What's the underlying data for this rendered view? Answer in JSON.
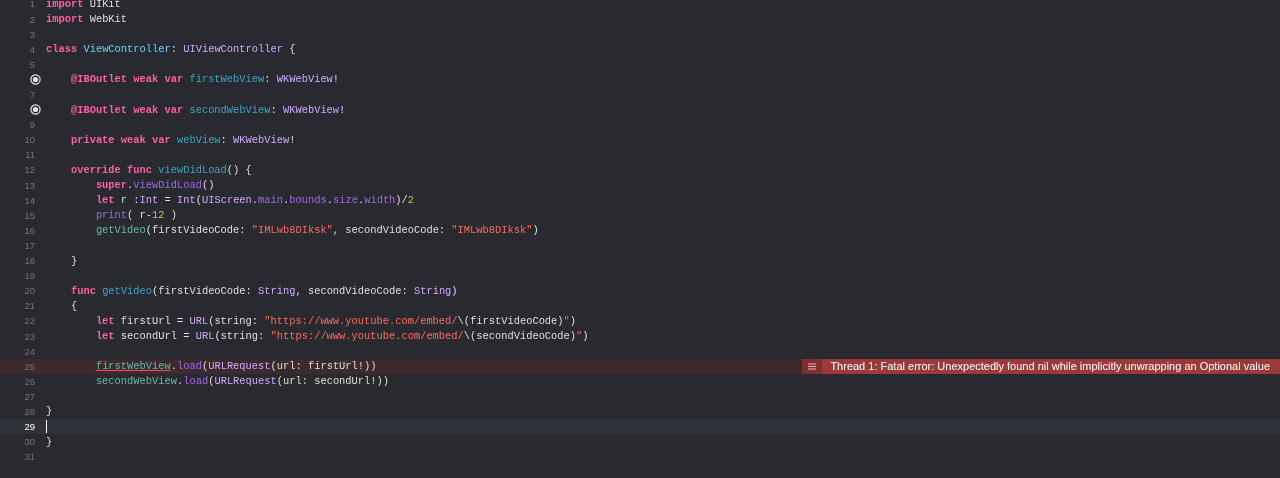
{
  "editor": {
    "lines": [
      {
        "number": "1",
        "current": false,
        "tokens": [
          {
            "text": "import",
            "kind": "keyword"
          },
          {
            "text": " UIKit",
            "kind": "plain"
          }
        ]
      },
      {
        "number": "2",
        "current": false,
        "tokens": [
          {
            "text": "import",
            "kind": "keyword"
          },
          {
            "text": " WebKit",
            "kind": "plain"
          }
        ]
      },
      {
        "number": "3",
        "current": false
      },
      {
        "number": "4",
        "current": false,
        "tokens": [
          {
            "text": "class ",
            "kind": "keyword"
          },
          {
            "text": "ViewController",
            "kind": "type-declaration"
          },
          {
            "text": ": ",
            "kind": "plain"
          },
          {
            "text": "UIViewController",
            "kind": "type"
          },
          {
            "text": " {",
            "kind": "plain"
          }
        ]
      },
      {
        "number": "5",
        "current": false
      },
      {
        "outlet": true,
        "current": false,
        "tokens": [
          {
            "text": "    @IBOutlet weak var ",
            "kind": "keyword"
          },
          {
            "text": "firstWebView",
            "kind": "declaration"
          },
          {
            "text": ": ",
            "kind": "plain"
          },
          {
            "text": "WKWebView",
            "kind": "type"
          },
          {
            "text": "!",
            "kind": "plain"
          }
        ]
      },
      {
        "number": "7",
        "current": false
      },
      {
        "outlet": true,
        "current": false,
        "tokens": [
          {
            "text": "    @IBOutlet weak var ",
            "kind": "keyword"
          },
          {
            "text": "secondWebView",
            "kind": "declaration"
          },
          {
            "text": ": ",
            "kind": "plain"
          },
          {
            "text": "WKWebView",
            "kind": "type"
          },
          {
            "text": "!",
            "kind": "plain"
          }
        ]
      },
      {
        "number": "9",
        "current": false
      },
      {
        "number": "10",
        "current": false,
        "tokens": [
          {
            "text": "    private weak var ",
            "kind": "keyword"
          },
          {
            "text": "webView",
            "kind": "declaration"
          },
          {
            "text": ": ",
            "kind": "plain"
          },
          {
            "text": "WKWebView",
            "kind": "type"
          },
          {
            "text": "!",
            "kind": "plain"
          }
        ]
      },
      {
        "number": "11",
        "current": false
      },
      {
        "number": "12",
        "current": false,
        "tokens": [
          {
            "text": "    override func ",
            "kind": "keyword"
          },
          {
            "text": "viewDidLoad",
            "kind": "declaration"
          },
          {
            "text": "() {",
            "kind": "plain"
          }
        ]
      },
      {
        "number": "13",
        "current": false,
        "tokens": [
          {
            "text": "        super",
            "kind": "keyword"
          },
          {
            "text": ".",
            "kind": "plain"
          },
          {
            "text": "viewDidLoad",
            "kind": "method"
          },
          {
            "text": "()",
            "kind": "plain"
          }
        ]
      },
      {
        "number": "14",
        "current": false,
        "tokens": [
          {
            "text": "        let",
            "kind": "keyword"
          },
          {
            "text": " r :",
            "kind": "plain"
          },
          {
            "text": "Int",
            "kind": "type"
          },
          {
            "text": " = ",
            "kind": "plain"
          },
          {
            "text": "Int",
            "kind": "type"
          },
          {
            "text": "(",
            "kind": "plain"
          },
          {
            "text": "UIScreen",
            "kind": "type"
          },
          {
            "text": ".",
            "kind": "plain"
          },
          {
            "text": "main",
            "kind": "method"
          },
          {
            "text": ".",
            "kind": "plain"
          },
          {
            "text": "bounds",
            "kind": "method"
          },
          {
            "text": ".",
            "kind": "plain"
          },
          {
            "text": "size",
            "kind": "method"
          },
          {
            "text": ".",
            "kind": "plain"
          },
          {
            "text": "width",
            "kind": "method"
          },
          {
            "text": ")/",
            "kind": "plain"
          },
          {
            "text": "2",
            "kind": "number"
          }
        ]
      },
      {
        "number": "15",
        "current": false,
        "tokens": [
          {
            "text": "        print",
            "kind": "method"
          },
          {
            "text": "( r-",
            "kind": "plain"
          },
          {
            "text": "12",
            "kind": "number"
          },
          {
            "text": " )",
            "kind": "plain"
          }
        ]
      },
      {
        "number": "16",
        "current": false,
        "tokens": [
          {
            "text": "        getVideo",
            "kind": "project"
          },
          {
            "text": "(firstVideoCode: ",
            "kind": "plain"
          },
          {
            "text": "\"IMLwb8DIksk\"",
            "kind": "string"
          },
          {
            "text": ", secondVideoCode: ",
            "kind": "plain"
          },
          {
            "text": "\"IMLwb8DIksk\"",
            "kind": "string"
          },
          {
            "text": ")",
            "kind": "plain"
          }
        ]
      },
      {
        "number": "17",
        "current": false
      },
      {
        "number": "18",
        "current": false,
        "tokens": [
          {
            "text": "    }",
            "kind": "plain"
          }
        ]
      },
      {
        "number": "19",
        "current": false
      },
      {
        "number": "20",
        "current": false,
        "tokens": [
          {
            "text": "    func ",
            "kind": "keyword"
          },
          {
            "text": "getVideo",
            "kind": "declaration"
          },
          {
            "text": "(firstVideoCode: ",
            "kind": "plain"
          },
          {
            "text": "String",
            "kind": "type"
          },
          {
            "text": ", secondVideoCode: ",
            "kind": "plain"
          },
          {
            "text": "String",
            "kind": "type"
          },
          {
            "text": ")",
            "kind": "plain"
          }
        ]
      },
      {
        "number": "21",
        "current": false,
        "tokens": [
          {
            "text": "    {",
            "kind": "plain"
          }
        ]
      },
      {
        "number": "22",
        "current": false,
        "tokens": [
          {
            "text": "        let",
            "kind": "keyword"
          },
          {
            "text": " firstUrl = ",
            "kind": "plain"
          },
          {
            "text": "URL",
            "kind": "type"
          },
          {
            "text": "(string: ",
            "kind": "plain"
          },
          {
            "text": "\"https://www.youtube.com/embed/",
            "kind": "string"
          },
          {
            "text": "\\(firstVideoCode)",
            "kind": "plain"
          },
          {
            "text": "\"",
            "kind": "string"
          },
          {
            "text": ")",
            "kind": "plain"
          }
        ]
      },
      {
        "number": "23",
        "current": false,
        "tokens": [
          {
            "text": "        let",
            "kind": "keyword"
          },
          {
            "text": " secondUrl = ",
            "kind": "plain"
          },
          {
            "text": "URL",
            "kind": "type"
          },
          {
            "text": "(string: ",
            "kind": "plain"
          },
          {
            "text": "\"https://www.youtube.com/embed/",
            "kind": "string"
          },
          {
            "text": "\\(secondVideoCode)",
            "kind": "plain"
          },
          {
            "text": "\"",
            "kind": "string"
          },
          {
            "text": ")",
            "kind": "plain"
          }
        ]
      },
      {
        "number": "24",
        "current": false
      },
      {
        "number": "25",
        "current": false,
        "error_message": "Thread 1: Fatal error: Unexpectedly found nil while implicitly unwrapping an Optional value",
        "tokens": [
          {
            "text": "        firstWebView",
            "kind": "error-symbol"
          },
          {
            "text": ".",
            "kind": "plain"
          },
          {
            "text": "load",
            "kind": "method"
          },
          {
            "text": "(",
            "kind": "plain"
          },
          {
            "text": "URLRequest",
            "kind": "type"
          },
          {
            "text": "(url: firstUrl!))",
            "kind": "plain"
          }
        ]
      },
      {
        "number": "26",
        "current": false,
        "tokens": [
          {
            "text": "        secondWebView",
            "kind": "project"
          },
          {
            "text": ".",
            "kind": "plain"
          },
          {
            "text": "load",
            "kind": "method"
          },
          {
            "text": "(",
            "kind": "plain"
          },
          {
            "text": "URLRequest",
            "kind": "type"
          },
          {
            "text": "(url: secondUrl!))",
            "kind": "plain"
          }
        ]
      },
      {
        "number": "27",
        "current": false
      },
      {
        "number": "28",
        "current": false,
        "tokens": [
          {
            "text": "}",
            "kind": "plain"
          }
        ]
      },
      {
        "number": "29",
        "current": true
      },
      {
        "number": "30",
        "current": false,
        "tokens": [
          {
            "text": "}",
            "kind": "plain"
          }
        ]
      },
      {
        "number": "31",
        "current": false
      }
    ]
  }
}
